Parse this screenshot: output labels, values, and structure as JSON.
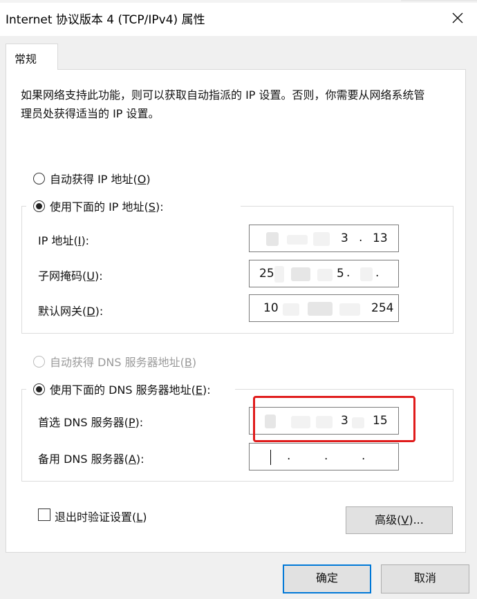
{
  "window": {
    "title": "Internet 协议版本 4 (TCP/IPv4) 属性"
  },
  "tabs": [
    {
      "label": "常规"
    }
  ],
  "description": "如果网络支持此功能，则可以获取自动指派的 IP 设置。否则，你需要从网络系统管理员处获得适当的 IP 设置。",
  "ip_section": {
    "auto_radio": {
      "label": "自动获得 IP 地址",
      "key": "O",
      "checked": false
    },
    "manual_radio": {
      "label": "使用下面的 IP 地址",
      "key": "S",
      "checked": true
    },
    "fields": [
      {
        "label": "IP 地址",
        "key": "I",
        "visible_tail": "13",
        "partial": "3"
      },
      {
        "label": "子网掩码",
        "key": "U",
        "visible_head": "25",
        "partial": "5"
      },
      {
        "label": "默认网关",
        "key": "D",
        "visible_head": "10",
        "visible_tail": "254"
      }
    ]
  },
  "dns_section": {
    "auto_radio": {
      "label": "自动获得 DNS 服务器地址",
      "key": "B",
      "enabled": false
    },
    "manual_radio": {
      "label": "使用下面的 DNS 服务器地址",
      "key": "E",
      "checked": true
    },
    "fields": [
      {
        "label": "首选 DNS 服务器",
        "key": "P",
        "partial": "3",
        "visible_tail": "15"
      },
      {
        "label": "备用 DNS 服务器",
        "key": "A"
      }
    ]
  },
  "validate_checkbox": {
    "label": "退出时验证设置",
    "key": "L",
    "checked": false
  },
  "buttons": {
    "advanced": {
      "label": "高级",
      "key": "V",
      "suffix": "..."
    },
    "ok": "确定",
    "cancel": "取消"
  },
  "colors": {
    "highlight": "#e01b1b",
    "focus": "#0078d7"
  }
}
